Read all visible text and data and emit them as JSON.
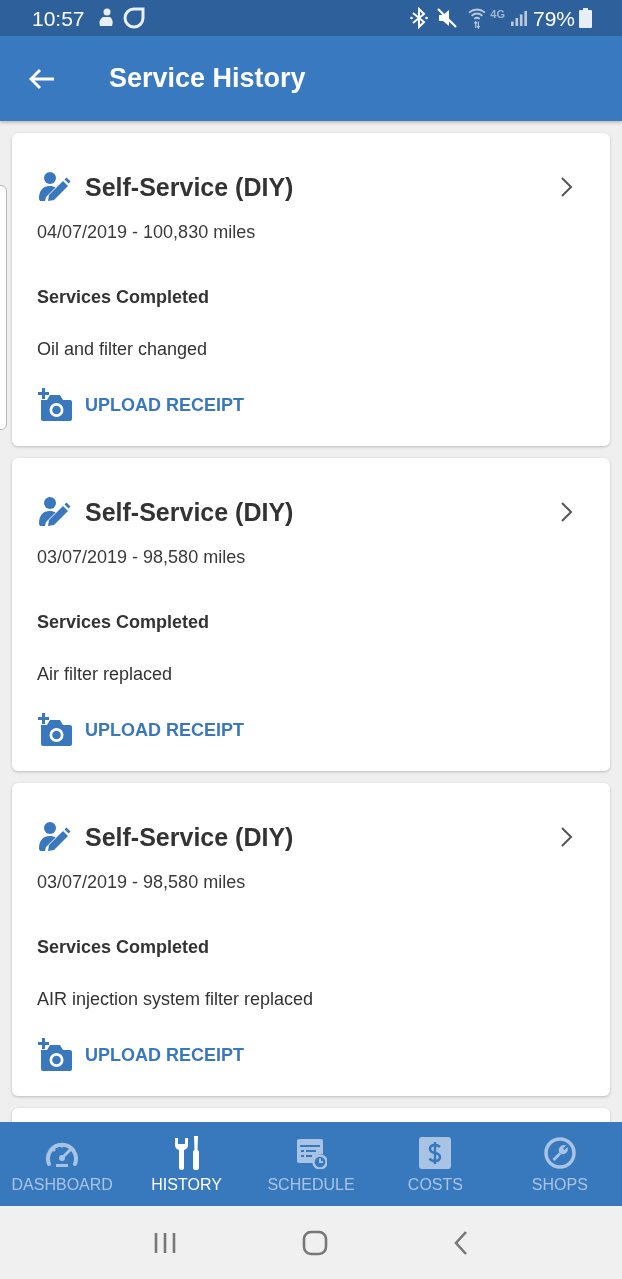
{
  "status_bar": {
    "time": "10:57",
    "network": "4G",
    "battery": "79%"
  },
  "app_bar": {
    "title": "Service History"
  },
  "records": [
    {
      "type": "Self-Service (DIY)",
      "date_mileage": "04/07/2019 - 100,830 miles",
      "section_label": "Services Completed",
      "services": "Oil and filter changed",
      "action": "UPLOAD RECEIPT"
    },
    {
      "type": "Self-Service (DIY)",
      "date_mileage": "03/07/2019 - 98,580 miles",
      "section_label": "Services Completed",
      "services": "Air filter replaced",
      "action": "UPLOAD RECEIPT"
    },
    {
      "type": "Self-Service (DIY)",
      "date_mileage": "03/07/2019 - 98,580 miles",
      "section_label": "Services Completed",
      "services": "AIR injection system filter replaced",
      "action": "UPLOAD RECEIPT"
    }
  ],
  "bottom_nav": [
    {
      "label": "DASHBOARD",
      "selected": false
    },
    {
      "label": "HISTORY",
      "selected": true
    },
    {
      "label": "SCHEDULE",
      "selected": false
    },
    {
      "label": "COSTS",
      "selected": false
    },
    {
      "label": "SHOPS",
      "selected": false
    }
  ]
}
